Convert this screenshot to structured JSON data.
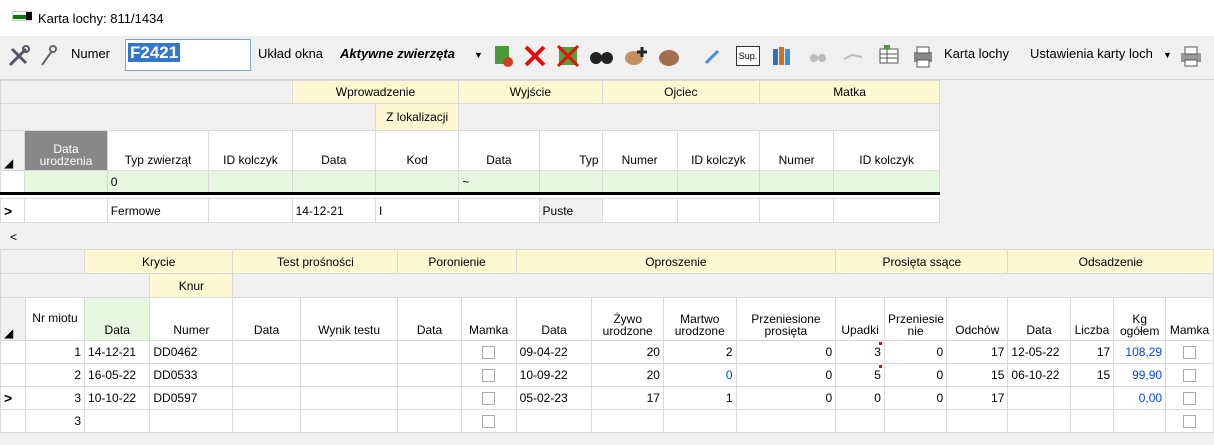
{
  "window": {
    "title": "Karta lochy: 811/1434"
  },
  "toolbar": {
    "numer_label": "Numer",
    "numer_value": "F2421",
    "uklad_label": "Układ okna",
    "uklad_value": "Aktywne zwierzęta",
    "sup_label": "Sup.",
    "karta_label": "Karta lochy",
    "ustawienia_value": "Ustawienia karty loch"
  },
  "top_grid": {
    "group_headers": {
      "wprowadzenie": "Wprowadzenie",
      "wyjscie": "Wyjście",
      "ojciec": "Ojciec",
      "matka": "Matka",
      "z_lokalizacji": "Z lokalizacji"
    },
    "columns": {
      "data_urodzenia": "Data urodzenia",
      "typ_zwierzat": "Typ zwierząt",
      "id_kolczyk": "ID kolczyk",
      "data_wpr": "Data",
      "kod": "Kod",
      "data_wyj": "Data",
      "typ": "Typ",
      "numer_oj": "Numer",
      "id_kolczyk_oj": "ID kolczyk",
      "numer_m": "Numer",
      "id_kolczyk_m": "ID kolczyk"
    },
    "filter_row": {
      "typ_zwierzat": "0",
      "data_wyj": "~"
    },
    "row": {
      "marker": ">",
      "typ_zwierzat": "Fermowe",
      "data_wpr": "14-12-21",
      "kod": "I",
      "typ": "Puste"
    }
  },
  "scroll": {
    "left_arrow": "<"
  },
  "bottom_grid": {
    "group_headers": {
      "krycie": "Krycie",
      "knur": "Knur",
      "test": "Test prośności",
      "poronienie": "Poronienie",
      "oproszenie": "Oproszenie",
      "prosieta": "Prosięta ssące",
      "odsadzenie": "Odsadzenie"
    },
    "columns": {
      "nr_miotu": "Nr miotu",
      "data_k": "Data",
      "numer": "Numer",
      "data_t": "Data",
      "wynik": "Wynik testu",
      "data_p": "Data",
      "mamka_p": "Mamka",
      "data_o": "Data",
      "zywo": "Żywo urodzone",
      "martwo": "Martwo urodzone",
      "przeniesione": "Przeniesione prosięta",
      "upadki": "Upadki",
      "przeniesienie": "Przeniesie nie",
      "odchow": "Odchów",
      "data_od": "Data",
      "liczba": "Liczba",
      "kg": "Kg ogółem",
      "mamka_o": "Mamka"
    },
    "rows": [
      {
        "marker": "",
        "nr": "1",
        "data_k": "14-12-21",
        "numer": "DD0462",
        "data_o": "09-04-22",
        "zywo": "20",
        "martwo": "2",
        "przen": "0",
        "upadki": "3",
        "przeniesienie": "0",
        "odchow": "17",
        "data_od": "12-05-22",
        "liczba": "17",
        "kg": "108,29"
      },
      {
        "marker": "",
        "nr": "2",
        "data_k": "16-05-22",
        "numer": "DD0533",
        "data_o": "10-09-22",
        "zywo": "20",
        "martwo": "0",
        "przen": "0",
        "upadki": "5",
        "przeniesienie": "0",
        "odchow": "15",
        "data_od": "06-10-22",
        "liczba": "15",
        "kg": "99,90"
      },
      {
        "marker": ">",
        "nr": "3",
        "data_k": "10-10-22",
        "numer": "DD0597",
        "data_o": "05-02-23",
        "zywo": "17",
        "martwo": "1",
        "przen": "0",
        "upadki": "0",
        "przeniesienie": "0",
        "odchow": "17",
        "data_od": "",
        "liczba": "",
        "kg": "0,00"
      },
      {
        "marker": "",
        "nr": "3",
        "data_k": "",
        "numer": "",
        "data_o": "",
        "zywo": "",
        "martwo": "",
        "przen": "",
        "upadki": "",
        "przeniesienie": "",
        "odchow": "",
        "data_od": "",
        "liczba": "",
        "kg": ""
      }
    ]
  },
  "colors": {
    "header_yellow": "#fdf7d2",
    "filter_green": "#e6f7e0",
    "blue_value": "#0044ff",
    "selection": "#3377cc"
  },
  "icons": [
    "tools-icon",
    "wrench-icon",
    "add-document-icon",
    "delete-icon",
    "delete-all-icon",
    "binoculars-icon",
    "pig-add-icon",
    "pig-icon",
    "syringe-icon",
    "sup-icon",
    "books-icon",
    "binoculars-disabled-icon",
    "chart-disabled-icon",
    "table-icon",
    "printer-grid-icon",
    "printer-icon"
  ]
}
